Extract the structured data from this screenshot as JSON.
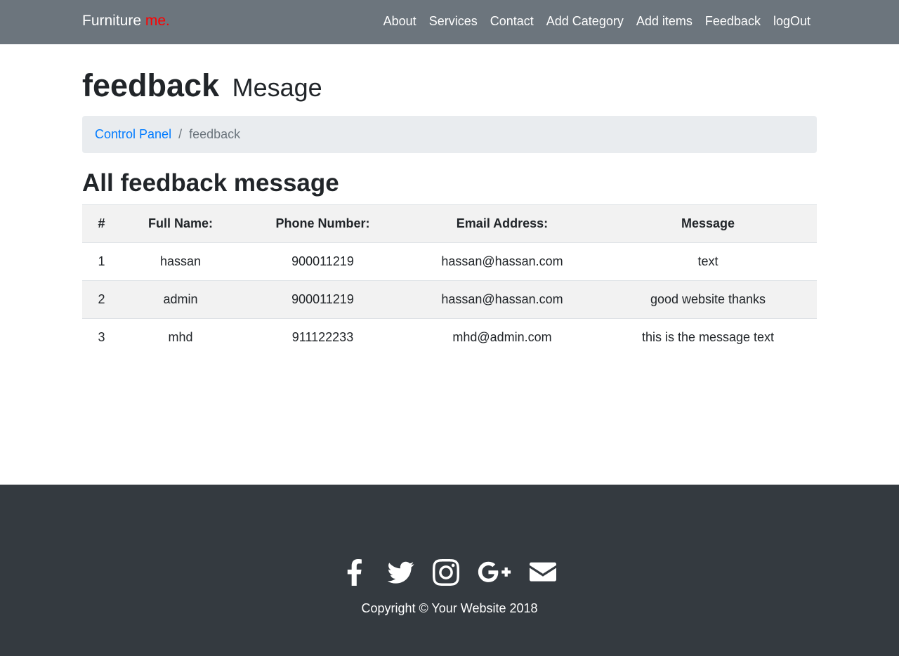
{
  "navbar": {
    "brand": "Furniture",
    "brand_accent": "me.",
    "links": [
      "About",
      "Services",
      "Contact",
      "Add Category",
      "Add items",
      "Feedback",
      "logOut"
    ]
  },
  "page": {
    "title": "feedback",
    "subtitle": "Mesage"
  },
  "breadcrumb": {
    "home": "Control Panel",
    "separator": "/",
    "current": "feedback"
  },
  "section_title": "All feedback message",
  "table": {
    "headers": [
      "#",
      "Full Name:",
      "Phone Number:",
      "Email Address:",
      "Message"
    ],
    "rows": [
      [
        "1",
        "hassan",
        "900011219",
        "hassan@hassan.com",
        "text"
      ],
      [
        "2",
        "admin",
        "900011219",
        "hassan@hassan.com",
        "good website thanks"
      ],
      [
        "3",
        "mhd",
        "911122233",
        "mhd@admin.com",
        "this is the message text"
      ]
    ]
  },
  "footer": {
    "social_icons": [
      "facebook-icon",
      "twitter-icon",
      "instagram-icon",
      "google-plus-icon",
      "envelope-icon"
    ],
    "copyright": "Copyright © Your Website 2018"
  },
  "colors": {
    "navbar_bg": "#6c757d",
    "brand_accent": "#ff0000",
    "link": "#007bff",
    "footer_bg": "#343a40"
  }
}
